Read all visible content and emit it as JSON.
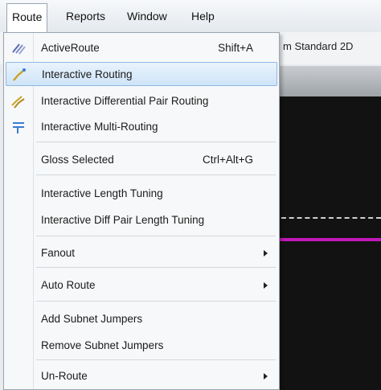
{
  "menubar": {
    "items": [
      "Route",
      "Reports",
      "Window",
      "Help"
    ]
  },
  "toolbar": {
    "view_label": "m Standard 2D"
  },
  "colors": {
    "highlight": "#cfe4f8",
    "canvas": "#121212",
    "trace": "#c218b8"
  },
  "route_menu": {
    "items": [
      {
        "label": "ActiveRoute",
        "shortcut": "Shift+A",
        "icon": "active-route-icon"
      },
      {
        "label": "Interactive Routing",
        "shortcut": "",
        "icon": "interactive-routing-icon",
        "highlighted": true
      },
      {
        "label": "Interactive Differential Pair Routing",
        "shortcut": "",
        "icon": "diff-pair-routing-icon"
      },
      {
        "label": "Interactive Multi-Routing",
        "shortcut": "",
        "icon": "multi-routing-icon"
      },
      {
        "label": "Gloss Selected",
        "shortcut": "Ctrl+Alt+G"
      },
      {
        "label": "Interactive Length Tuning",
        "shortcut": ""
      },
      {
        "label": "Interactive Diff Pair Length Tuning",
        "shortcut": ""
      },
      {
        "label": "Fanout",
        "submenu": true
      },
      {
        "label": "Auto Route",
        "submenu": true
      },
      {
        "label": "Add Subnet Jumpers",
        "shortcut": ""
      },
      {
        "label": "Remove Subnet Jumpers",
        "shortcut": ""
      },
      {
        "label": "Un-Route",
        "submenu": true
      }
    ]
  }
}
